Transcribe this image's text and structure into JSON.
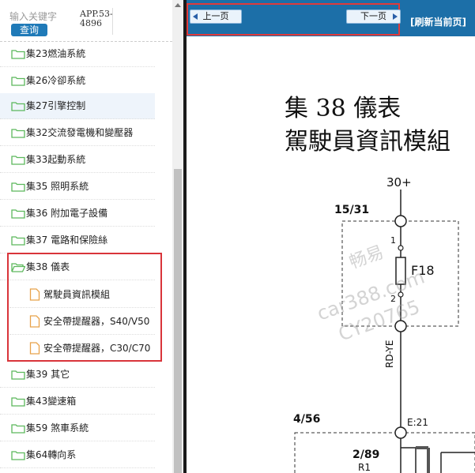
{
  "search": {
    "placeholder": "输入关键字",
    "button": "查询",
    "code": "APP.53-4896"
  },
  "tree": {
    "items": [
      {
        "label": "集23燃油系統"
      },
      {
        "label": "集26冷卻系統"
      },
      {
        "label": "集27引擎控制"
      },
      {
        "label": "集32交流發電機和變壓器"
      },
      {
        "label": "集33起動系統"
      },
      {
        "label": "集35 照明系統"
      },
      {
        "label": "集36 附加電子設備"
      },
      {
        "label": "集37 電路和保險絲"
      },
      {
        "label": "集38 儀表",
        "children": [
          {
            "label": "駕駛員資訊模組"
          },
          {
            "label": "安全帶提醒器，S40/V50"
          },
          {
            "label": "安全帶提醒器，C30/C70"
          }
        ]
      },
      {
        "label": "集39 其它"
      },
      {
        "label": "集43變速箱"
      },
      {
        "label": "集59 煞車系統"
      },
      {
        "label": "集64轉向系"
      }
    ]
  },
  "toolbar": {
    "prev": "上一页",
    "next": "下一页",
    "refresh": "[刷新当前页]"
  },
  "document": {
    "title_line1": "集 38  儀表",
    "title_line2": "駕駛員資訊模組",
    "labels": {
      "supply": "30+",
      "conn_1531": "15/31",
      "pin1": "1",
      "pin2": "2",
      "fuse": "F18",
      "wire": "RD-YE",
      "conn_456": "4/56",
      "e21": "E:21",
      "conn_289": "2/89",
      "r1": "R1"
    },
    "watermark": {
      "line1": "畅易",
      "line2": "car388.com",
      "line3": "CY20765"
    }
  },
  "colors": {
    "toolbar": "#1c6fa8",
    "highlight": "#d9343a",
    "button": "#1f7ab8",
    "folder": "#5cb85c",
    "doc_icon": "#e8a24a"
  }
}
